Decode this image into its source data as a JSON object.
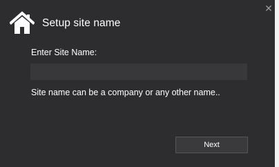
{
  "dialog": {
    "title": "Setup site name",
    "title_icon": "home-icon",
    "close_glyph": "✕",
    "close_icon": "close-icon"
  },
  "form": {
    "label": "Enter Site Name:",
    "input_value": "",
    "input_placeholder": "",
    "hint": "Site name can be a company or any other name.."
  },
  "actions": {
    "next_label": "Next"
  },
  "colors": {
    "background": "#2d2d2f",
    "input_background": "#38383b",
    "button_background": "#3a3a3d",
    "text": "#ffffff",
    "close_glyph": "#9a9a9a"
  }
}
